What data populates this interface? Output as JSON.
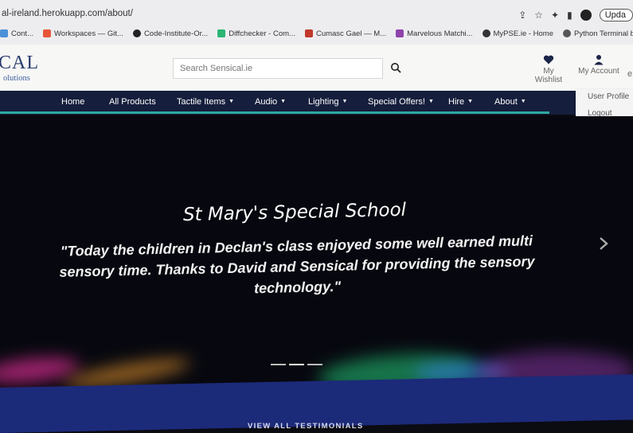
{
  "browser": {
    "url": "al-ireland.herokuapp.com/about/",
    "update_label": "Upda",
    "bookmarks": [
      {
        "label": "Cont...",
        "color": "#4a90d9"
      },
      {
        "label": "Workspaces — Git...",
        "color": "#e8563a"
      },
      {
        "label": "Code-Institute-Or...",
        "color": "#222222"
      },
      {
        "label": "Diffchecker - Com...",
        "color": "#2bb673"
      },
      {
        "label": "Cumasc Gael — M...",
        "color": "#c0392b"
      },
      {
        "label": "Marvelous Matchi...",
        "color": "#8e44ad"
      },
      {
        "label": "MyPSE.ie - Home",
        "color": "#333333"
      },
      {
        "label": "Python Terminal b...",
        "color": "#555555"
      }
    ]
  },
  "header": {
    "logo_main": "CAL",
    "logo_sub": "olutions",
    "search_placeholder": "Search Sensical.ie",
    "wishlist_label": "My Wishlist",
    "account_label": "My Account",
    "edge_letter": "e"
  },
  "nav": {
    "items": [
      {
        "label": "Home",
        "caret": ""
      },
      {
        "label": "All Products",
        "caret": ""
      },
      {
        "label": "Tactile Items",
        "caret": "▼"
      },
      {
        "label": "Audio",
        "caret": "▼"
      },
      {
        "label": "Lighting",
        "caret": "▼"
      },
      {
        "label": "Special Offers!",
        "caret": "▼"
      },
      {
        "label": "Hire",
        "caret": "▼"
      },
      {
        "label": "About",
        "caret": "▼"
      }
    ]
  },
  "account_menu": {
    "items": [
      "User Profile",
      "Logout"
    ]
  },
  "hero": {
    "title": "St Mary's Special School",
    "quote": "\"Today the children in Declan's class enjoyed some well earned multi sensory time. Thanks to David and Sensical for providing the sensory technology.\"",
    "slides": 3,
    "active_slide": 2
  },
  "footer_link": "VIEW ALL TESTIMONIALS",
  "colors": {
    "nav_bg": "#151e3c",
    "nav_accent": "#2ea7a0",
    "logo": "#2a3d6e",
    "band": "#1c2a7a"
  }
}
